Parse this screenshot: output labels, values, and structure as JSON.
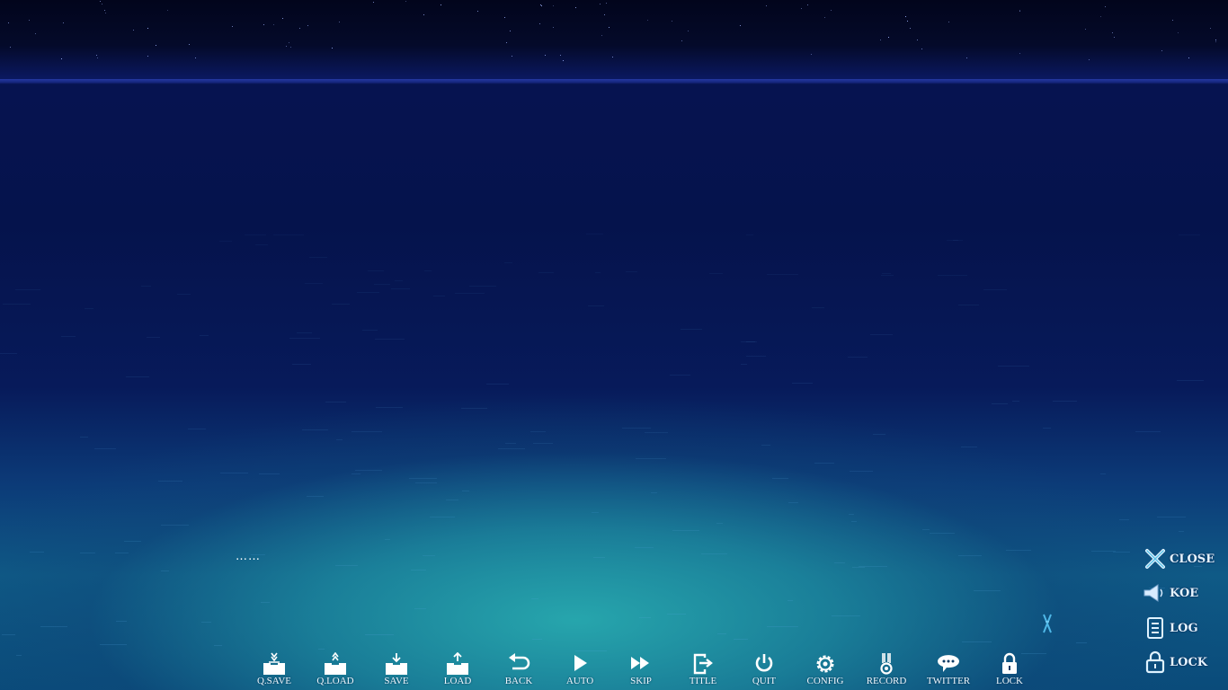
{
  "dialogue": {
    "text": "……"
  },
  "side_menu": [
    {
      "id": "close",
      "label": "CLOSE",
      "icon": "close-icon"
    },
    {
      "id": "koe",
      "label": "KOE",
      "icon": "speaker-icon"
    },
    {
      "id": "log",
      "label": "LOG",
      "icon": "document-icon"
    },
    {
      "id": "lock",
      "label": "LOCK",
      "icon": "padlock-icon"
    }
  ],
  "bottom_bar": [
    {
      "id": "qsave",
      "label": "Q.SAVE",
      "icon": "quick-save-icon"
    },
    {
      "id": "qload",
      "label": "Q.LOAD",
      "icon": "quick-load-icon"
    },
    {
      "id": "save",
      "label": "SAVE",
      "icon": "save-icon"
    },
    {
      "id": "load",
      "label": "LOAD",
      "icon": "load-icon"
    },
    {
      "id": "back",
      "label": "BACK",
      "icon": "back-arrow-icon"
    },
    {
      "id": "auto",
      "label": "AUTO",
      "icon": "play-icon"
    },
    {
      "id": "skip",
      "label": "SKIP",
      "icon": "fast-forward-icon"
    },
    {
      "id": "title",
      "label": "TITLE",
      "icon": "exit-door-icon"
    },
    {
      "id": "quit",
      "label": "QUIT",
      "icon": "power-icon"
    },
    {
      "id": "config",
      "label": "CONFIG",
      "icon": "gear-icon"
    },
    {
      "id": "record",
      "label": "RECORD",
      "icon": "medal-icon"
    },
    {
      "id": "twitter",
      "label": "TWITTER",
      "icon": "speech-bubble-icon"
    },
    {
      "id": "lock",
      "label": "LOCK",
      "icon": "padlock-icon"
    }
  ],
  "colors": {
    "ui_text": "#eef8ff",
    "sky": "#040a2a",
    "sea": "#05134c",
    "glow": "#28aaaf"
  }
}
